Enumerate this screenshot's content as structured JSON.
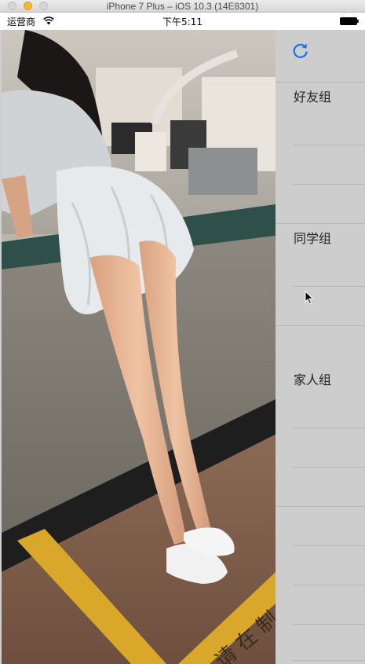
{
  "window": {
    "title": "iPhone 7 Plus – iOS 10.3 (14E8301)"
  },
  "status_bar": {
    "carrier": "运营商",
    "time": "下午5:11",
    "wifi_icon": "wifi-icon",
    "battery_icon": "battery-icon"
  },
  "photo": {
    "floor_text": "请 在 制"
  },
  "side_menu": {
    "refresh_icon": "refresh-icon",
    "accent_color": "#1a73e8",
    "groups": [
      {
        "label": "好友组"
      },
      {
        "label": "同学组"
      },
      {
        "label": "家人组"
      }
    ]
  }
}
